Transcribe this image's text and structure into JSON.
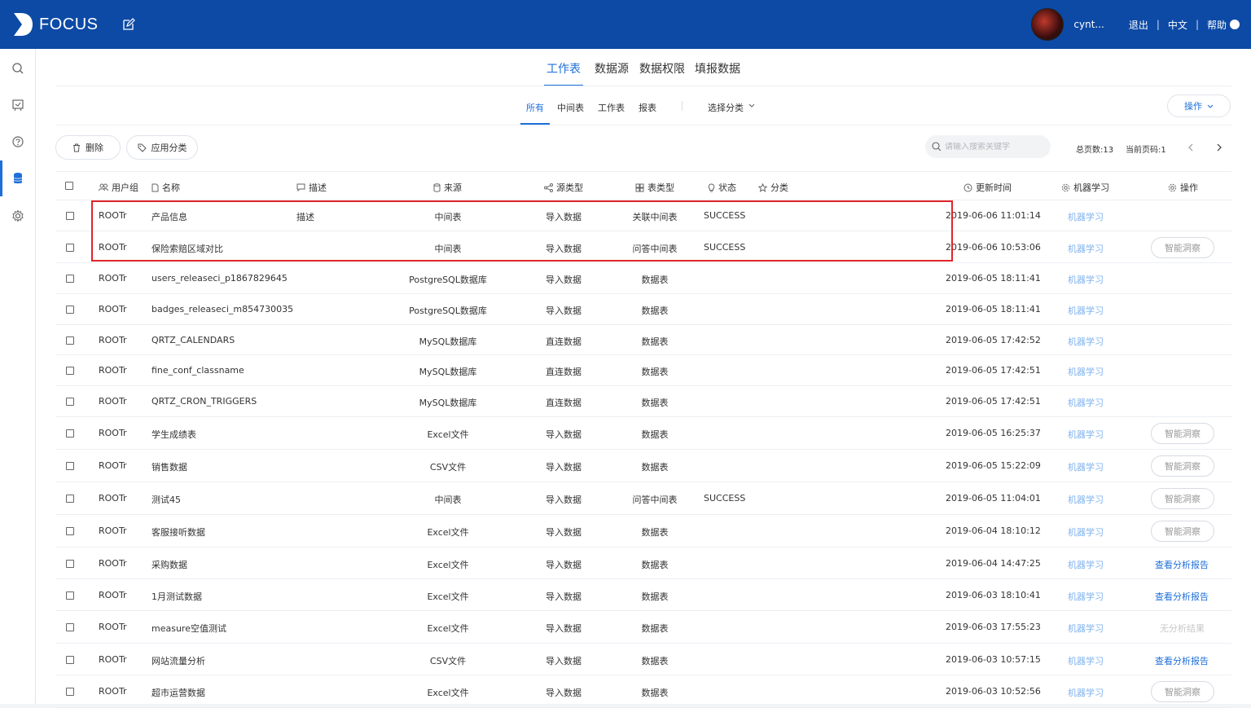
{
  "header": {
    "logo_text": "FOCUS",
    "user_name": "cynt...",
    "logout": "退出",
    "language": "中文",
    "help": "帮助",
    "help_mark": "?"
  },
  "sidebar": {
    "items": [
      {
        "icon": "search-icon"
      },
      {
        "icon": "chat-board-icon"
      },
      {
        "icon": "help-icon"
      },
      {
        "icon": "database-icon",
        "active": true
      },
      {
        "icon": "gear-icon"
      }
    ]
  },
  "tabs_primary": [
    "工作表",
    "数据源",
    "数据权限",
    "填报数据"
  ],
  "tabs_secondary": [
    "所有",
    "中间表",
    "工作表",
    "报表"
  ],
  "category_select": "选择分类",
  "operate_button": "操作",
  "toolbar": {
    "delete": "删除",
    "apply_category": "应用分类",
    "search_placeholder": "请输入搜索关键字",
    "total_pages": "总页数:13",
    "current_page": "当前页码:1"
  },
  "columns": {
    "user_group": "用户组",
    "name": "名称",
    "description": "描述",
    "source": "来源",
    "source_type": "源类型",
    "table_type": "表类型",
    "status": "状态",
    "category": "分类",
    "update_time": "更新时间",
    "ml": "机器学习",
    "actions": "操作"
  },
  "rows": [
    {
      "group": "ROOTr",
      "name": "产品信息",
      "desc": "描述",
      "source": "中间表",
      "stype": "导入数据",
      "ttype": "关联中间表",
      "status": "SUCCESS",
      "time": "2019-06-06 11:01:14",
      "ml": "机器学习",
      "action": ""
    },
    {
      "group": "ROOTr",
      "name": "保险索赔区域对比",
      "desc": "",
      "source": "中间表",
      "stype": "导入数据",
      "ttype": "问答中间表",
      "status": "SUCCESS",
      "time": "2019-06-06 10:53:06",
      "ml": "机器学习",
      "action": "智能洞察"
    },
    {
      "group": "ROOTr",
      "name": "users_releaseci_p1867829645",
      "desc": "",
      "source": "PostgreSQL数据库",
      "stype": "导入数据",
      "ttype": "数据表",
      "status": "",
      "time": "2019-06-05 18:11:41",
      "ml": "机器学习",
      "action": ""
    },
    {
      "group": "ROOTr",
      "name": "badges_releaseci_m854730035",
      "desc": "",
      "source": "PostgreSQL数据库",
      "stype": "导入数据",
      "ttype": "数据表",
      "status": "",
      "time": "2019-06-05 18:11:41",
      "ml": "机器学习",
      "action": ""
    },
    {
      "group": "ROOTr",
      "name": "QRTZ_CALENDARS",
      "desc": "",
      "source": "MySQL数据库",
      "stype": "直连数据",
      "ttype": "数据表",
      "status": "",
      "time": "2019-06-05 17:42:52",
      "ml": "机器学习",
      "action": ""
    },
    {
      "group": "ROOTr",
      "name": "fine_conf_classname",
      "desc": "",
      "source": "MySQL数据库",
      "stype": "直连数据",
      "ttype": "数据表",
      "status": "",
      "time": "2019-06-05 17:42:51",
      "ml": "机器学习",
      "action": ""
    },
    {
      "group": "ROOTr",
      "name": "QRTZ_CRON_TRIGGERS",
      "desc": "",
      "source": "MySQL数据库",
      "stype": "直连数据",
      "ttype": "数据表",
      "status": "",
      "time": "2019-06-05 17:42:51",
      "ml": "机器学习",
      "action": ""
    },
    {
      "group": "ROOTr",
      "name": "学生成绩表",
      "desc": "",
      "source": "Excel文件",
      "stype": "导入数据",
      "ttype": "数据表",
      "status": "",
      "time": "2019-06-05 16:25:37",
      "ml": "机器学习",
      "action": "智能洞察"
    },
    {
      "group": "ROOTr",
      "name": "销售数据",
      "desc": "",
      "source": "CSV文件",
      "stype": "导入数据",
      "ttype": "数据表",
      "status": "",
      "time": "2019-06-05 15:22:09",
      "ml": "机器学习",
      "action": "智能洞察"
    },
    {
      "group": "ROOTr",
      "name": "测试45",
      "desc": "",
      "source": "中间表",
      "stype": "导入数据",
      "ttype": "问答中间表",
      "status": "SUCCESS",
      "time": "2019-06-05 11:04:01",
      "ml": "机器学习",
      "action": "智能洞察"
    },
    {
      "group": "ROOTr",
      "name": "客服接听数据",
      "desc": "",
      "source": "Excel文件",
      "stype": "导入数据",
      "ttype": "数据表",
      "status": "",
      "time": "2019-06-04 18:10:12",
      "ml": "机器学习",
      "action": "智能洞察"
    },
    {
      "group": "ROOTr",
      "name": "采购数据",
      "desc": "",
      "source": "Excel文件",
      "stype": "导入数据",
      "ttype": "数据表",
      "status": "",
      "time": "2019-06-04 14:47:25",
      "ml": "机器学习",
      "action": "查看分析报告"
    },
    {
      "group": "ROOTr",
      "name": "1月测试数据",
      "desc": "",
      "source": "Excel文件",
      "stype": "导入数据",
      "ttype": "数据表",
      "status": "",
      "time": "2019-06-03 18:10:41",
      "ml": "机器学习",
      "action": "查看分析报告"
    },
    {
      "group": "ROOTr",
      "name": "measure空值测试",
      "desc": "",
      "source": "Excel文件",
      "stype": "导入数据",
      "ttype": "数据表",
      "status": "",
      "time": "2019-06-03 17:55:23",
      "ml": "机器学习",
      "action": "无分析结果"
    },
    {
      "group": "ROOTr",
      "name": "网站流量分析",
      "desc": "",
      "source": "CSV文件",
      "stype": "导入数据",
      "ttype": "数据表",
      "status": "",
      "time": "2019-06-03 10:57:15",
      "ml": "机器学习",
      "action": "查看分析报告"
    },
    {
      "group": "ROOTr",
      "name": "超市运营数据",
      "desc": "",
      "source": "Excel文件",
      "stype": "导入数据",
      "ttype": "数据表",
      "status": "",
      "time": "2019-06-03 10:52:56",
      "ml": "机器学习",
      "action": "智能洞察"
    }
  ]
}
